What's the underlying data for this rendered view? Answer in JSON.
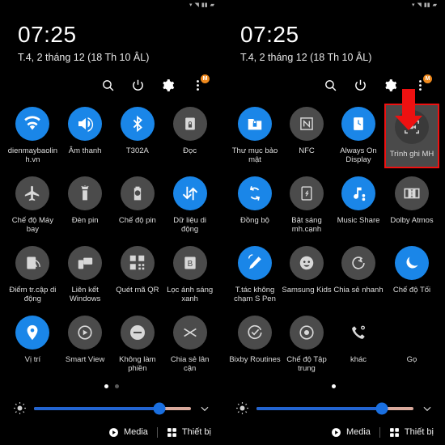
{
  "device": {
    "status_bar_icons": [
      "signal-icon",
      "wifi-icon",
      "signal-bars-icon",
      "battery-icon"
    ]
  },
  "header": {
    "clock": "07:25",
    "date": "T.4, 2 tháng 12 (18 Th 10 ÂL)",
    "actions": [
      {
        "name": "search-icon",
        "label": "Tìm kiếm"
      },
      {
        "name": "power-icon",
        "label": "Nguồn"
      },
      {
        "name": "gear-icon",
        "label": "Cài đặt"
      },
      {
        "name": "overflow-menu-icon",
        "label": "Thêm",
        "badge": "M"
      }
    ]
  },
  "panels": [
    {
      "id": "panel-left",
      "tiles": [
        {
          "label": "dienmaybaolinh.vn",
          "icon": "wifi-icon",
          "state": "on"
        },
        {
          "label": "Âm thanh",
          "icon": "sound-icon",
          "state": "on"
        },
        {
          "label": "T302A",
          "icon": "bluetooth-icon",
          "state": "on"
        },
        {
          "label": "Đọc",
          "icon": "secure-doc-icon",
          "state": "off"
        },
        {
          "label": "Chế độ Máy bay",
          "icon": "airplane-icon",
          "state": "off"
        },
        {
          "label": "Đèn pin",
          "icon": "flashlight-icon",
          "state": "off"
        },
        {
          "label": "Chế độ pin",
          "icon": "battery-saver-icon",
          "state": "off"
        },
        {
          "label": "Dữ liệu di động",
          "icon": "mobile-data-icon",
          "state": "on"
        },
        {
          "label": "Điểm tr.cập di động",
          "icon": "hotspot-icon",
          "state": "off"
        },
        {
          "label": "Liên kết Windows",
          "icon": "windows-link-icon",
          "state": "off"
        },
        {
          "label": "Quét mã QR",
          "icon": "qr-scan-icon",
          "state": "off"
        },
        {
          "label": "Lọc ánh sáng xanh",
          "icon": "blue-light-filter-icon",
          "state": "off"
        },
        {
          "label": "Vị trí",
          "icon": "location-pin-icon",
          "state": "on"
        },
        {
          "label": "Smart View",
          "icon": "smart-view-icon",
          "state": "off"
        },
        {
          "label": "Không làm phiền",
          "icon": "do-not-disturb-icon",
          "state": "off"
        },
        {
          "label": "Chia sẻ lân cận",
          "icon": "nearby-share-icon",
          "state": "off"
        }
      ],
      "page_dots": {
        "count": 2,
        "active": 0
      }
    },
    {
      "id": "panel-right",
      "tiles": [
        {
          "label": "Thư mục bảo mật",
          "icon": "secure-folder-icon",
          "state": "on"
        },
        {
          "label": "NFC",
          "icon": "nfc-icon",
          "state": "off"
        },
        {
          "label": "Always On Display",
          "icon": "always-on-display-icon",
          "state": "on"
        },
        {
          "label": "Trình ghi MH",
          "icon": "screen-recorder-icon",
          "state": "off",
          "highlighted": true
        },
        {
          "label": "Đồng bộ",
          "icon": "sync-icon",
          "state": "on"
        },
        {
          "label": "Bật sáng mh.cạnh",
          "icon": "edge-lighting-icon",
          "state": "off"
        },
        {
          "label": "Music Share",
          "icon": "music-share-icon",
          "state": "on"
        },
        {
          "label": "Dolby Atmos",
          "icon": "dolby-atmos-icon",
          "state": "off"
        },
        {
          "label": "T.tác không chạm S Pen",
          "icon": "s-pen-air-action-icon",
          "state": "on"
        },
        {
          "label": "Samsung Kids",
          "icon": "samsung-kids-icon",
          "state": "off"
        },
        {
          "label": "Chia sẻ nhanh",
          "icon": "quick-share-icon",
          "state": "off"
        },
        {
          "label": "Chế độ Tối",
          "icon": "dark-mode-icon",
          "state": "on"
        },
        {
          "label": "Bixby Routines",
          "icon": "bixby-routines-icon",
          "state": "off"
        },
        {
          "label": "Chế độ Tập trung",
          "icon": "focus-mode-icon",
          "state": "off"
        },
        {
          "label": "khác",
          "icon": "call-icon",
          "state": "off"
        },
        {
          "label": "Gọ",
          "icon": "blank-icon",
          "state": "none"
        }
      ],
      "page_dots": {
        "count": 1,
        "active": 0
      }
    }
  ],
  "brightness": {
    "value_percent": 80,
    "icon": "brightness-sun-icon",
    "expand_icon": "chevron-down-icon"
  },
  "footer": {
    "media_label": "Media",
    "media_icon": "play-circle-icon",
    "devices_label": "Thiết bị",
    "devices_icon": "grid-squares-icon"
  },
  "annotation": {
    "type": "arrow-and-box",
    "color": "#ee1111",
    "target_label": "Trình ghi MH"
  },
  "colors": {
    "background": "#000000",
    "tile_on": "#1a86e8",
    "tile_off": "#4b4b4b",
    "annotation": "#ee1111",
    "slider_fill": "#2264d1"
  }
}
